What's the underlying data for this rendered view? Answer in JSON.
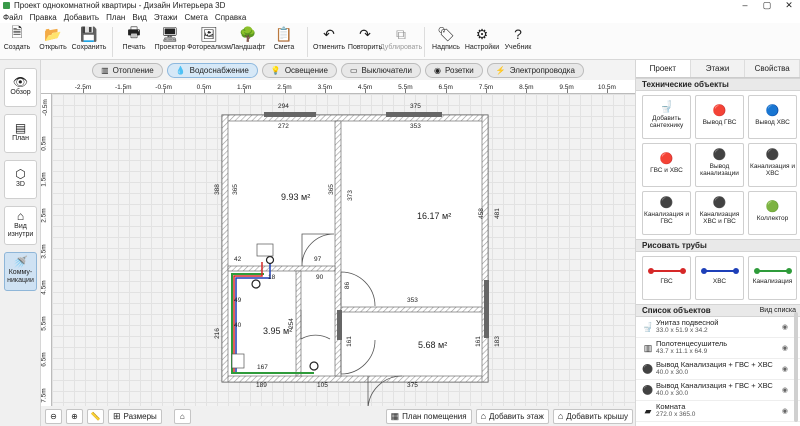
{
  "window": {
    "title": "Проект однокомнатной квартиры - Дизайн Интерьера 3D"
  },
  "menu": [
    "Файл",
    "Правка",
    "Добавить",
    "План",
    "Вид",
    "Этажи",
    "Смета",
    "Справка"
  ],
  "toolbar": [
    {
      "label": "Создать",
      "icon": "new-file-icon",
      "glyph": "🗎"
    },
    {
      "label": "Открыть",
      "icon": "folder-icon",
      "glyph": "📂"
    },
    {
      "label": "Сохранить",
      "icon": "save-icon",
      "glyph": "💾"
    },
    {
      "label": "Печать",
      "icon": "print-icon",
      "glyph": "🖶"
    },
    {
      "label": "Проектор",
      "icon": "monitor-icon",
      "glyph": "🖥"
    },
    {
      "label": "Фотореализм",
      "icon": "photo-icon",
      "glyph": "🖼"
    },
    {
      "label": "Ландшафт",
      "icon": "landscape-icon",
      "glyph": "🌳"
    },
    {
      "label": "Смета",
      "icon": "estimate-icon",
      "glyph": "📋"
    },
    {
      "label": "Отменить",
      "icon": "undo-icon",
      "glyph": "↶"
    },
    {
      "label": "Повторить",
      "icon": "redo-icon",
      "glyph": "↷"
    },
    {
      "label": "Дублировать",
      "icon": "duplicate-icon",
      "glyph": "⧉"
    },
    {
      "label": "Надпись",
      "icon": "label-icon",
      "glyph": "🏷"
    },
    {
      "label": "Настройки",
      "icon": "gear-icon",
      "glyph": "⚙"
    },
    {
      "label": "Учебник",
      "icon": "help-icon",
      "glyph": "?"
    }
  ],
  "left_panel": [
    {
      "label": "Обзор",
      "icon": "eye-icon",
      "glyph": "👁"
    },
    {
      "label": "План",
      "icon": "plan-icon",
      "glyph": "▤"
    },
    {
      "label": "3D",
      "icon": "cube-icon",
      "glyph": "⬡"
    },
    {
      "label": "Вид изнутри",
      "icon": "inside-view-icon",
      "glyph": "⌂"
    },
    {
      "label": "Комму-никации",
      "icon": "communications-icon",
      "glyph": "🚿"
    }
  ],
  "modes": [
    {
      "label": "Отопление",
      "icon": "heating-icon",
      "glyph": "▥"
    },
    {
      "label": "Водоснабжение",
      "icon": "water-icon",
      "glyph": "💧"
    },
    {
      "label": "Освещение",
      "icon": "light-icon",
      "glyph": "💡"
    },
    {
      "label": "Выключатели",
      "icon": "switch-icon",
      "glyph": "▭"
    },
    {
      "label": "Розетки",
      "icon": "socket-icon",
      "glyph": "◉"
    },
    {
      "label": "Электропроводка",
      "icon": "wiring-icon",
      "glyph": "⚡"
    }
  ],
  "ruler_ticks": [
    "-2.5m",
    "-1.5m",
    "-0.5m",
    "0.5m",
    "1.5m",
    "2.5m",
    "3.5m",
    "4.5m",
    "5.5m",
    "6.5m",
    "7.5m",
    "8.5m",
    "9.5m",
    "10.5m"
  ],
  "vruler_ticks": [
    "-0.5m",
    "0.5m",
    "1.5m",
    "2.5m",
    "3.5m",
    "4.5m",
    "5.5m",
    "6.5m",
    "7.5m"
  ],
  "plan": {
    "rooms": [
      "9.93 м²",
      "16.17 м²",
      "3.95 м²",
      "5.68 м²"
    ],
    "dims": [
      "294",
      "375",
      "272",
      "353",
      "388",
      "365",
      "365",
      "373",
      "458",
      "481",
      "42",
      "97",
      "90",
      "86",
      "18",
      "49",
      "40",
      "254",
      "216",
      "167",
      "189",
      "105",
      "161",
      "161",
      "353",
      "375",
      "183"
    ]
  },
  "bottom": {
    "sizes": "Размеры",
    "room_plan": "План помещения",
    "add_floor": "Добавить этаж",
    "add_roof": "Добавить крышу"
  },
  "right_panel": {
    "tabs": [
      "Проект",
      "Этажи",
      "Свойства"
    ],
    "tech_title": "Технические объекты",
    "tech": [
      {
        "label": "Добавить сантехнику",
        "icon": "plumbing-add-icon",
        "glyph": "🚽"
      },
      {
        "label": "Вывод ГВС",
        "icon": "hot-water-outlet-icon",
        "glyph": "🔴"
      },
      {
        "label": "Вывод ХВС",
        "icon": "cold-water-outlet-icon",
        "glyph": "🔵"
      },
      {
        "label": "ГВС и ХВС",
        "icon": "hot-cold-outlet-icon",
        "glyph": "🔴"
      },
      {
        "label": "Вывод канализации",
        "icon": "sewer-outlet-icon",
        "glyph": "⚫"
      },
      {
        "label": "Канализация и ХВС",
        "icon": "sewer-cold-icon",
        "glyph": "⚫"
      },
      {
        "label": "Канализация и ГВС",
        "icon": "sewer-hot-icon",
        "glyph": "⚫"
      },
      {
        "label": "Канализация ХВС и ГВС",
        "icon": "sewer-hot-cold-icon",
        "glyph": "⚫"
      },
      {
        "label": "Коллектор",
        "icon": "manifold-icon",
        "glyph": "🟢"
      }
    ],
    "pipes_title": "Рисовать трубы",
    "pipes": [
      {
        "label": "ГВС",
        "color": "#d62828"
      },
      {
        "label": "ХВС",
        "color": "#1d3fb8"
      },
      {
        "label": "Канализация",
        "color": "#2e9b3a"
      }
    ],
    "list_title": "Список объектов",
    "list_view": "Вид списка",
    "objects": [
      {
        "name": "Унитаз подвесной",
        "size": "33.0 x 51.9 x 34.2",
        "icon": "toilet-icon",
        "glyph": "🚽"
      },
      {
        "name": "Полотенцесушитель",
        "size": "43.7 x 11.1 x 64.9",
        "icon": "towel-dryer-icon",
        "glyph": "▥"
      },
      {
        "name": "Вывод Канализация + ГВС + ХВС",
        "size": "40.0 x 30.0",
        "icon": "outlet-icon",
        "glyph": "⚫"
      },
      {
        "name": "Вывод Канализация + ГВС + ХВС",
        "size": "40.0 x 30.0",
        "icon": "outlet-icon",
        "glyph": "⚫"
      },
      {
        "name": "Комната",
        "size": "272.0 x 365.0",
        "icon": "room-icon",
        "glyph": "▰"
      }
    ]
  }
}
